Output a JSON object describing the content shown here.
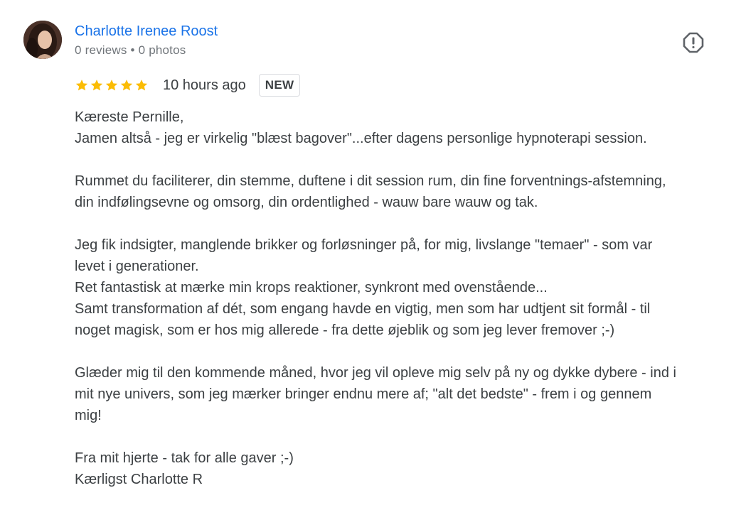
{
  "reviewer": {
    "name": "Charlotte Irenee Roost",
    "reviews": "0 reviews",
    "separator": "•",
    "photos": "0 photos",
    "avatar_icon": "profile-photo"
  },
  "review": {
    "rating": 5,
    "rating_max": 5,
    "time": "10 hours ago",
    "badge": "NEW",
    "star_color": "#fbbc04",
    "lines": [
      "Kæreste Pernille,",
      "Jamen altså - jeg er virkelig \"blæst bagover\"...efter dagens personlige hypnoterapi session.",
      "",
      "Rummet du faciliterer, din stemme, duftene i dit session rum, din fine forventnings-afstemning,",
      "din indfølingsevne og omsorg, din ordentlighed - wauw bare wauw og tak.",
      "",
      "Jeg fik indsigter, manglende brikker og forløsninger på, for mig, livslange \"temaer\" - som var",
      "levet i generationer.",
      "Ret fantastisk at mærke min krops reaktioner, synkront med ovenstående...",
      "Samt transformation af dét, som engang havde en vigtig, men som har udtjent sit formål - til",
      "noget magisk, som er hos mig allerede - fra dette øjeblik og som jeg lever fremover ;-)",
      "",
      "Glæder mig til den kommende måned, hvor jeg vil opleve mig selv på ny og dykke dybere - ind i",
      "mit nye univers, som jeg mærker bringer endnu mere af; \"alt det bedste\" - frem i og gennem",
      "mig!",
      "",
      "Fra mit hjerte - tak for alle gaver ;-)",
      "Kærligst Charlotte R"
    ]
  },
  "actions": {
    "flag_icon": "report-alert-icon"
  },
  "colors": {
    "name_link": "#1a73e8",
    "meta_text": "#70757a",
    "body_text": "#3c4043",
    "badge_border": "#dadce0"
  }
}
